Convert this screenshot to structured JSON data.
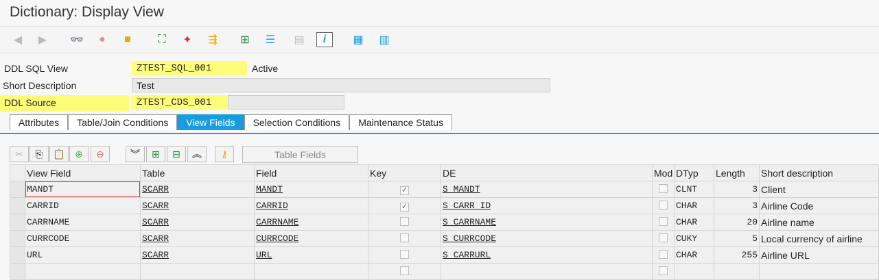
{
  "title": "Dictionary: Display View",
  "header": {
    "ddl_sql_view_label": "DDL SQL View",
    "ddl_sql_view_value": "ZTEST_SQL_001",
    "status": "Active",
    "short_desc_label": "Short Description",
    "short_desc_value": "Test",
    "ddl_source_label": "DDL Source",
    "ddl_source_value": "ZTEST_CDS_001"
  },
  "tabs": [
    "Attributes",
    "Table/Join Conditions",
    "View Fields",
    "Selection Conditions",
    "Maintenance Status"
  ],
  "table_fields_button": "Table Fields",
  "columns": [
    "View Field",
    "Table",
    "Field",
    "Key",
    "DE",
    "Mod",
    "DTyp",
    "Length",
    "Short description"
  ],
  "rows": [
    {
      "view_field": "MANDT",
      "table": "SCARR",
      "field": "MANDT",
      "key": true,
      "de": "S_MANDT",
      "mod": false,
      "dtyp": "CLNT",
      "length": "3",
      "desc": "Client"
    },
    {
      "view_field": "CARRID",
      "table": "SCARR",
      "field": "CARRID",
      "key": true,
      "de": "S_CARR_ID",
      "mod": false,
      "dtyp": "CHAR",
      "length": "3",
      "desc": "Airline Code"
    },
    {
      "view_field": "CARRNAME",
      "table": "SCARR",
      "field": "CARRNAME",
      "key": false,
      "de": "S_CARRNAME",
      "mod": false,
      "dtyp": "CHAR",
      "length": "20",
      "desc": "Airline name"
    },
    {
      "view_field": "CURRCODE",
      "table": "SCARR",
      "field": "CURRCODE",
      "key": false,
      "de": "S_CURRCODE",
      "mod": false,
      "dtyp": "CUKY",
      "length": "5",
      "desc": "Local currency of airline"
    },
    {
      "view_field": "URL",
      "table": "SCARR",
      "field": "URL",
      "key": false,
      "de": "S_CARRURL",
      "mod": false,
      "dtyp": "CHAR",
      "length": "255",
      "desc": "Airline URL"
    }
  ],
  "colors": {
    "accent": "#1a9be0",
    "highlight": "#fdfd7a"
  }
}
